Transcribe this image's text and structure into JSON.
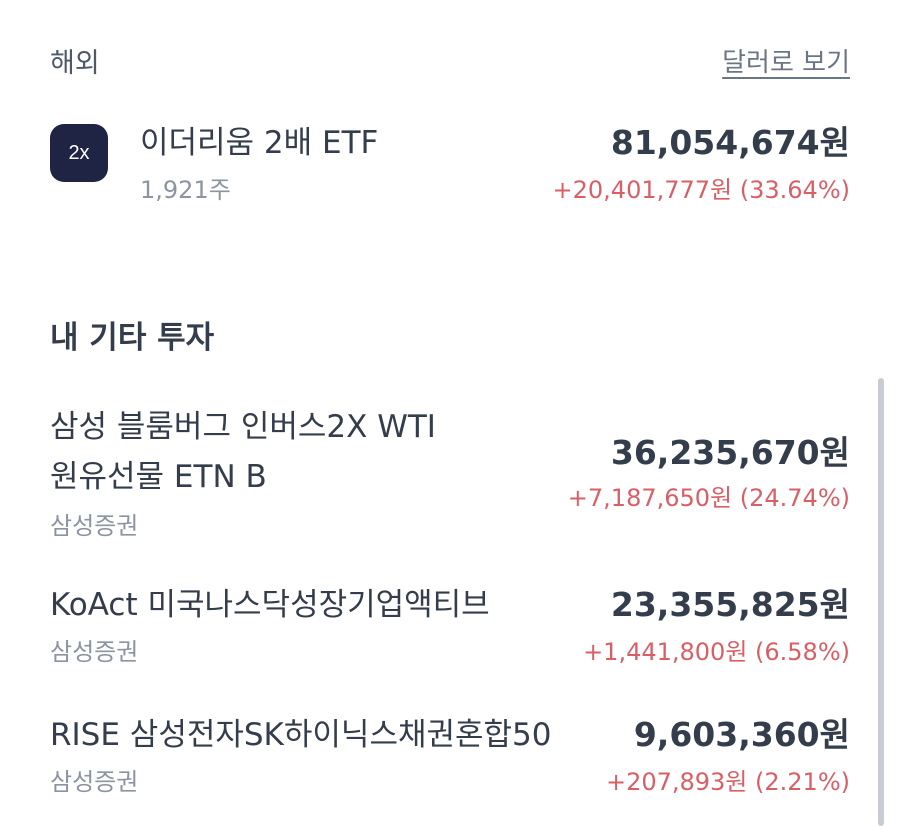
{
  "overseas": {
    "title": "해외",
    "dollar_view_label": "달러로 보기",
    "holdings": [
      {
        "logo_text": "2x",
        "name": "이더리움 2배 ETF",
        "quantity": "1,921주",
        "amount": "81,054,674원",
        "change": "+20,401,777원 (33.64%)"
      }
    ]
  },
  "other": {
    "title": "내 기타 투자",
    "holdings": [
      {
        "name_line1": "삼성 블룸버그 인버스2X WTI",
        "name_line2": "원유선물 ETN B",
        "broker": "삼성증권",
        "amount": "36,235,670원",
        "change": "+7,187,650원 (24.74%)"
      },
      {
        "name": "KoAct 미국나스닥성장기업액티브",
        "broker": "삼성증권",
        "amount": "23,355,825원",
        "change": "+1,441,800원 (6.58%)"
      },
      {
        "name": "RISE 삼성전자SK하이닉스채권혼합50",
        "broker": "삼성증권",
        "amount": "9,603,360원",
        "change": "+207,893원 (2.21%)"
      }
    ]
  },
  "colors": {
    "gain": "#d95f66",
    "logo_bg": "#1f2344",
    "primary_text": "#333d4b",
    "secondary_text": "#8b95a1"
  }
}
